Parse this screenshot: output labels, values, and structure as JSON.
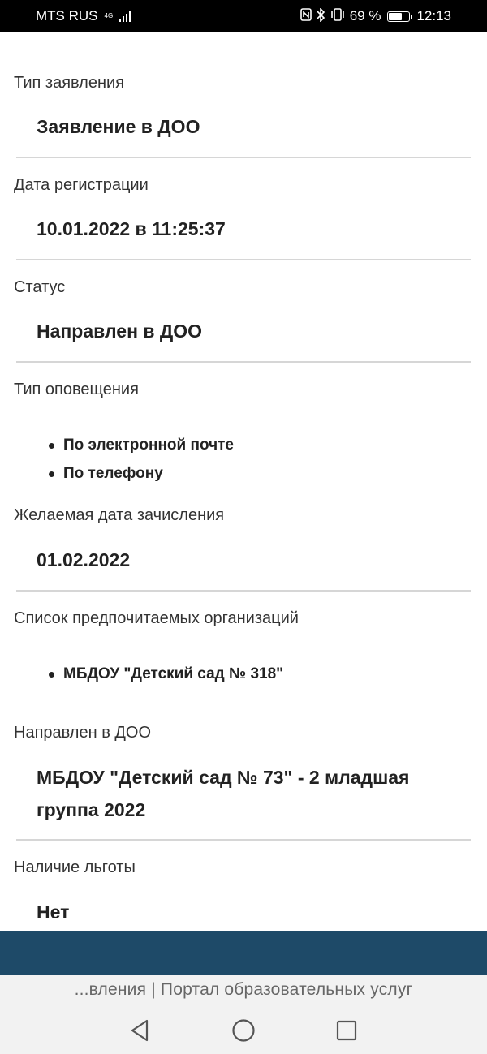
{
  "status_bar": {
    "carrier": "MTS RUS",
    "network": "4G",
    "battery": "69 %",
    "battery_level": 0.69,
    "time": "12:13",
    "icons": [
      "nfc-icon",
      "bluetooth-icon",
      "vibrate-icon"
    ]
  },
  "fields": [
    {
      "label": "Тип заявления",
      "value": "Заявление в ДОО"
    },
    {
      "label": "Дата регистрации",
      "value": "10.01.2022 в 11:25:37"
    },
    {
      "label": "Статус",
      "value": "Направлен в ДОО"
    },
    {
      "label": "Тип оповещения",
      "items": [
        "По электронной почте",
        "По телефону"
      ]
    },
    {
      "label": "Желаемая дата зачисления",
      "value": "01.02.2022"
    },
    {
      "label": "Список предпочитаемых организаций",
      "items": [
        "МБДОУ \"Детский сад № 318\""
      ]
    },
    {
      "label": "Направлен в ДОО",
      "value": "МБДОУ \"Детский сад № 73\" - 2 младшая группа 2022"
    },
    {
      "label": "Наличие льготы",
      "value": "Нет"
    }
  ],
  "browser": {
    "page_title": "...вления | Портал образовательных услуг"
  },
  "colors": {
    "accent_bar": "#1e4a68",
    "divider": "#d6d6d6"
  }
}
